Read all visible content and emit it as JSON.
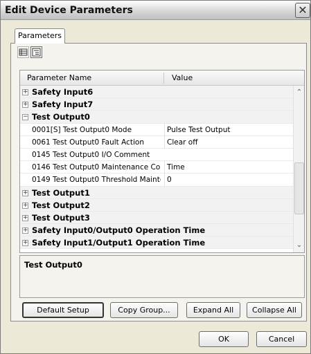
{
  "window": {
    "title": "Edit Device Parameters",
    "close_glyph": "✕"
  },
  "tabs": [
    {
      "label": "Parameters"
    }
  ],
  "toolbar": {
    "icons": [
      "list-view-icon",
      "group-view-icon"
    ]
  },
  "grid": {
    "headers": {
      "name": "Parameter Name",
      "value": "Value"
    },
    "rows": [
      {
        "type": "group",
        "expander": "+",
        "label": "Safety Input6"
      },
      {
        "type": "group",
        "expander": "+",
        "label": "Safety Input7"
      },
      {
        "type": "group",
        "expander": "−",
        "label": "Test Output0"
      },
      {
        "type": "param",
        "name": "0001[S] Test Output0 Mode",
        "value": "Pulse Test Output"
      },
      {
        "type": "param",
        "name": "0061 Test Output0 Fault Action",
        "value": "Clear off"
      },
      {
        "type": "param",
        "name": "0145 Test Output0 I/O Comment",
        "value": ""
      },
      {
        "type": "param",
        "name": "0146 Test Output0 Maintenance Cou",
        "value": "Time"
      },
      {
        "type": "param",
        "name": "0149 Test Output0 Threshold Mainte",
        "value": "0"
      },
      {
        "type": "group",
        "expander": "+",
        "label": "Test Output1"
      },
      {
        "type": "group",
        "expander": "+",
        "label": "Test Output2"
      },
      {
        "type": "group",
        "expander": "+",
        "label": "Test Output3"
      },
      {
        "type": "group",
        "expander": "+",
        "label": "Safety Input0/Output0 Operation Time"
      },
      {
        "type": "group",
        "expander": "+",
        "label": "Safety Input1/Output1 Operation Time"
      }
    ],
    "scroll_up_glyph": "⌃",
    "scroll_down_glyph": "⌄"
  },
  "description": {
    "title": "Test Output0"
  },
  "buttons": {
    "default_setup": "Default Setup",
    "copy_group": "Copy Group...",
    "expand_all": "Expand All",
    "collapse_all": "Collapse All",
    "ok": "OK",
    "cancel": "Cancel"
  }
}
